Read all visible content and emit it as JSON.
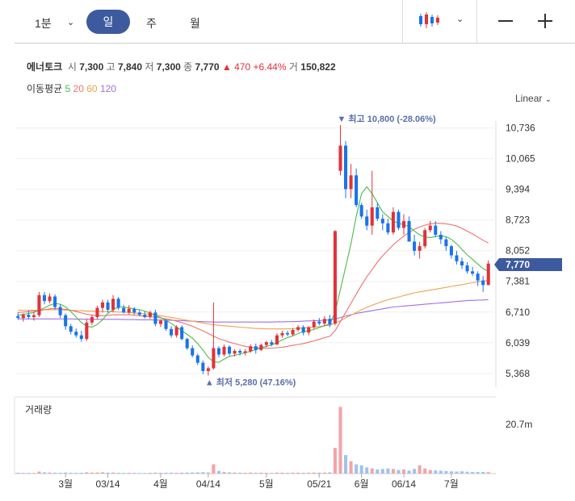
{
  "toolbar": {
    "interval": "1분",
    "tabs": [
      "일",
      "주",
      "월"
    ],
    "selected": "일",
    "chart_icon": "candlestick-icon",
    "minus": "—",
    "plus": "+"
  },
  "info": {
    "name": "에너토크",
    "open_label": "시",
    "open": "7,300",
    "high_label": "고",
    "high": "7,840",
    "low_label": "저",
    "low": "7,300",
    "close_label": "종",
    "close": "7,770",
    "change": "▲ 470",
    "change_pct": "+6.44%",
    "volume_label": "거",
    "volume": "150,822"
  },
  "ma": {
    "label": "이동평균",
    "p5": "5",
    "p20": "20",
    "p60": "60",
    "p120": "120"
  },
  "scale": "Linear",
  "colors": {
    "up": "#e0323a",
    "down": "#1a73e8",
    "ma5": "#4cbb4c",
    "ma20": "#f07070",
    "ma60": "#f0a050",
    "ma120": "#a070e0",
    "accent": "#3d5a9e"
  },
  "chart_data": {
    "type": "candlestick",
    "y_ticks": [
      "10,736",
      "10,065",
      "9,394",
      "8,723",
      "8,052",
      "7,381",
      "6,710",
      "6,039",
      "5,368"
    ],
    "y_tick_values": [
      10736,
      10065,
      9394,
      8723,
      8052,
      7381,
      6710,
      6039,
      5368
    ],
    "ylim": [
      5100,
      11100
    ],
    "x_ticks": [
      "3월",
      "03/14",
      "4월",
      "04/14",
      "5월",
      "05/21",
      "6월",
      "06/14",
      "7월"
    ],
    "x_tick_index": [
      9,
      17,
      27,
      36,
      47,
      57,
      65,
      73,
      82
    ],
    "current_price": "7,770",
    "max_annotation": "▼ 최고 10,800 (-28.06%)",
    "min_annotation": "▲ 최저 5,280 (47.16%)",
    "volume_label": "거래량",
    "volume_tick": "20.7m",
    "ohlc": [
      [
        6620,
        6700,
        6540,
        6580
      ],
      [
        6580,
        6680,
        6500,
        6650
      ],
      [
        6650,
        6740,
        6560,
        6600
      ],
      [
        6600,
        6700,
        6520,
        6640
      ],
      [
        6640,
        7150,
        6600,
        7080
      ],
      [
        7080,
        7150,
        6880,
        6950
      ],
      [
        6950,
        7120,
        6900,
        7050
      ],
      [
        7050,
        7100,
        6760,
        6820
      ],
      [
        6820,
        6880,
        6580,
        6640
      ],
      [
        6640,
        6680,
        6320,
        6400
      ],
      [
        6400,
        6450,
        6220,
        6280
      ],
      [
        6280,
        6350,
        6150,
        6200
      ],
      [
        6200,
        6300,
        6060,
        6120
      ],
      [
        6120,
        6550,
        6080,
        6480
      ],
      [
        6480,
        6650,
        6420,
        6600
      ],
      [
        6600,
        6850,
        6560,
        6800
      ],
      [
        6800,
        6980,
        6700,
        6920
      ],
      [
        6920,
        6980,
        6700,
        6760
      ],
      [
        6760,
        7080,
        6700,
        7000
      ],
      [
        7000,
        7040,
        6750,
        6800
      ],
      [
        6800,
        6870,
        6680,
        6700
      ],
      [
        6700,
        6860,
        6660,
        6780
      ],
      [
        6780,
        6820,
        6650,
        6700
      ],
      [
        6700,
        6750,
        6620,
        6650
      ],
      [
        6650,
        6720,
        6570,
        6600
      ],
      [
        6600,
        6740,
        6560,
        6700
      ],
      [
        6700,
        6760,
        6400,
        6450
      ],
      [
        6450,
        6550,
        6380,
        6520
      ],
      [
        6520,
        6560,
        6300,
        6340
      ],
      [
        6340,
        6400,
        6150,
        6200
      ],
      [
        6200,
        6420,
        6150,
        6380
      ],
      [
        6380,
        6420,
        6090,
        6120
      ],
      [
        6120,
        6150,
        5880,
        5920
      ],
      [
        5920,
        5980,
        5720,
        5760
      ],
      [
        5760,
        5800,
        5550,
        5600
      ],
      [
        5600,
        5650,
        5350,
        5420
      ],
      [
        5420,
        5520,
        5320,
        5480
      ],
      [
        5480,
        6920,
        5450,
        5920
      ],
      [
        5920,
        5960,
        5720,
        5780
      ],
      [
        5780,
        6000,
        5740,
        5950
      ],
      [
        5950,
        5980,
        5760,
        5800
      ],
      [
        5800,
        5900,
        5740,
        5860
      ],
      [
        5860,
        5900,
        5760,
        5820
      ],
      [
        5820,
        5900,
        5760,
        5850
      ],
      [
        5850,
        6000,
        5820,
        5960
      ],
      [
        5960,
        6020,
        5800,
        5880
      ],
      [
        5880,
        6020,
        5860,
        5990
      ],
      [
        5990,
        6080,
        5940,
        6050
      ],
      [
        6050,
        6100,
        5960,
        6000
      ],
      [
        6000,
        6250,
        5990,
        6200
      ],
      [
        6200,
        6300,
        6150,
        6250
      ],
      [
        6250,
        6300,
        6180,
        6220
      ],
      [
        6220,
        6350,
        6180,
        6320
      ],
      [
        6320,
        6420,
        6280,
        6380
      ],
      [
        6380,
        6420,
        6200,
        6260
      ],
      [
        6260,
        6400,
        6200,
        6380
      ],
      [
        6380,
        6550,
        6340,
        6500
      ],
      [
        6500,
        6580,
        6420,
        6460
      ],
      [
        6460,
        6620,
        6400,
        6560
      ],
      [
        6560,
        6650,
        6380,
        6440
      ],
      [
        6460,
        8500,
        6420,
        8480
      ],
      [
        9800,
        10800,
        9700,
        10350
      ],
      [
        10350,
        10450,
        9200,
        9400
      ],
      [
        9400,
        9950,
        9200,
        9700
      ],
      [
        9700,
        9850,
        9000,
        9050
      ],
      [
        9050,
        9100,
        8750,
        8800
      ],
      [
        8800,
        8950,
        8500,
        8600
      ],
      [
        8600,
        9800,
        8400,
        9000
      ],
      [
        9000,
        9100,
        8700,
        8750
      ],
      [
        8750,
        8850,
        8500,
        8650
      ],
      [
        8650,
        8750,
        8400,
        8450
      ],
      [
        8450,
        9000,
        8400,
        8900
      ],
      [
        8900,
        8950,
        8500,
        8550
      ],
      [
        8550,
        8850,
        8400,
        8700
      ],
      [
        8700,
        8800,
        8250,
        8250
      ],
      [
        8250,
        8400,
        7950,
        8050
      ],
      [
        8050,
        8250,
        7880,
        8150
      ],
      [
        8150,
        8550,
        8100,
        8500
      ],
      [
        8500,
        8700,
        8450,
        8600
      ],
      [
        8600,
        8700,
        8350,
        8400
      ],
      [
        8400,
        8480,
        8200,
        8300
      ],
      [
        8300,
        8350,
        8050,
        8150
      ],
      [
        8150,
        8180,
        7880,
        7950
      ],
      [
        7950,
        8050,
        7750,
        7820
      ],
      [
        7820,
        7900,
        7650,
        7730
      ],
      [
        7730,
        7800,
        7550,
        7600
      ],
      [
        7600,
        7700,
        7500,
        7550
      ],
      [
        7550,
        7600,
        7280,
        7400
      ],
      [
        7400,
        7500,
        7150,
        7300
      ],
      [
        7300,
        7840,
        7300,
        7770
      ]
    ],
    "ma5": [
      6640,
      6660,
      6680,
      6700,
      6750,
      6800,
      6860,
      6900,
      6880,
      6820,
      6720,
      6600,
      6480,
      6400,
      6380,
      6440,
      6540,
      6680,
      6760,
      6820,
      6820,
      6800,
      6780,
      6760,
      6730,
      6690,
      6640,
      6590,
      6530,
      6460,
      6380,
      6300,
      6220,
      6140,
      6020,
      5880,
      5720,
      5620,
      5610,
      5680,
      5740,
      5760,
      5790,
      5820,
      5850,
      5890,
      5930,
      5960,
      5990,
      6040,
      6100,
      6150,
      6190,
      6240,
      6280,
      6300,
      6330,
      6370,
      6410,
      6450,
      6700,
      7200,
      7700,
      8200,
      8800,
      9300,
      9450,
      9300,
      9100,
      8900,
      8800,
      8700,
      8650,
      8620,
      8580,
      8480,
      8400,
      8350,
      8340,
      8360,
      8380,
      8360,
      8300,
      8200,
      8080,
      7960,
      7860,
      7760,
      7660,
      7600,
      7560
    ],
    "ma20": [
      6700,
      6710,
      6720,
      6730,
      6740,
      6760,
      6780,
      6790,
      6780,
      6770,
      6750,
      6720,
      6690,
      6660,
      6640,
      6630,
      6630,
      6640,
      6650,
      6650,
      6650,
      6650,
      6640,
      6630,
      6620,
      6610,
      6600,
      6580,
      6560,
      6540,
      6510,
      6480,
      6440,
      6400,
      6350,
      6300,
      6240,
      6180,
      6130,
      6090,
      6050,
      6020,
      5990,
      5960,
      5940,
      5930,
      5920,
      5920,
      5920,
      5930,
      5940,
      5960,
      5980,
      6000,
      6020,
      6050,
      6080,
      6110,
      6150,
      6180,
      6300,
      6500,
      6700,
      6900,
      7100,
      7300,
      7480,
      7640,
      7800,
      7940,
      8060,
      8180,
      8280,
      8370,
      8450,
      8520,
      8570,
      8610,
      8640,
      8650,
      8650,
      8640,
      8620,
      8590,
      8540,
      8480,
      8420,
      8350,
      8280,
      8220,
      8160
    ],
    "ma60": [
      6750,
      6750,
      6750,
      6750,
      6750,
      6760,
      6760,
      6760,
      6760,
      6750,
      6750,
      6740,
      6740,
      6730,
      6730,
      6720,
      6720,
      6720,
      6720,
      6710,
      6710,
      6700,
      6690,
      6680,
      6670,
      6660,
      6640,
      6630,
      6610,
      6590,
      6570,
      6550,
      6530,
      6510,
      6490,
      6470,
      6450,
      6430,
      6420,
      6410,
      6400,
      6390,
      6380,
      6370,
      6360,
      6350,
      6350,
      6340,
      6340,
      6340,
      6340,
      6340,
      6350,
      6350,
      6360,
      6370,
      6380,
      6390,
      6410,
      6420,
      6460,
      6520,
      6580,
      6640,
      6700,
      6760,
      6810,
      6860,
      6900,
      6940,
      6980,
      7010,
      7040,
      7070,
      7100,
      7130,
      7150,
      7170,
      7190,
      7210,
      7230,
      7250,
      7270,
      7290,
      7310,
      7330,
      7350,
      7370,
      7390,
      7400,
      7420
    ],
    "ma120": [
      6560,
      6560,
      6560,
      6560,
      6560,
      6560,
      6560,
      6560,
      6560,
      6560,
      6560,
      6555,
      6555,
      6555,
      6550,
      6550,
      6550,
      6550,
      6550,
      6550,
      6545,
      6545,
      6545,
      6540,
      6540,
      6540,
      6535,
      6535,
      6530,
      6530,
      6525,
      6520,
      6515,
      6510,
      6505,
      6500,
      6495,
      6490,
      6490,
      6490,
      6490,
      6490,
      6490,
      6490,
      6490,
      6490,
      6490,
      6490,
      6490,
      6495,
      6495,
      6500,
      6500,
      6505,
      6510,
      6515,
      6520,
      6525,
      6530,
      6540,
      6560,
      6590,
      6620,
      6650,
      6680,
      6700,
      6720,
      6740,
      6760,
      6780,
      6800,
      6820,
      6830,
      6840,
      6850,
      6860,
      6870,
      6880,
      6890,
      6900,
      6910,
      6920,
      6930,
      6940,
      6950,
      6960,
      6965,
      6970,
      6975,
      6980,
      6985
    ],
    "volume": [
      0.08,
      0.06,
      0.07,
      0.06,
      0.2,
      0.12,
      0.1,
      0.09,
      0.08,
      0.1,
      0.08,
      0.07,
      0.08,
      0.12,
      0.1,
      0.11,
      0.13,
      0.09,
      0.1,
      0.08,
      0.07,
      0.08,
      0.07,
      0.06,
      0.06,
      0.07,
      0.09,
      0.07,
      0.08,
      0.09,
      0.08,
      0.09,
      0.1,
      0.11,
      0.12,
      0.14,
      0.1,
      0.9,
      0.25,
      0.15,
      0.12,
      0.1,
      0.09,
      0.08,
      0.1,
      0.08,
      0.09,
      0.08,
      0.07,
      0.1,
      0.09,
      0.08,
      0.09,
      0.09,
      0.08,
      0.09,
      0.1,
      0.09,
      0.1,
      0.12,
      2.5,
      6.5,
      1.8,
      1.2,
      0.9,
      0.8,
      0.6,
      0.5,
      0.4,
      0.45,
      0.5,
      0.45,
      0.35,
      0.4,
      0.3,
      0.45,
      0.8,
      0.5,
      0.35,
      0.3,
      0.28,
      0.25,
      0.22,
      0.2,
      0.22,
      0.18,
      0.16,
      0.15,
      0.16,
      0.14,
      0.15
    ],
    "volume_max": 7.0
  }
}
